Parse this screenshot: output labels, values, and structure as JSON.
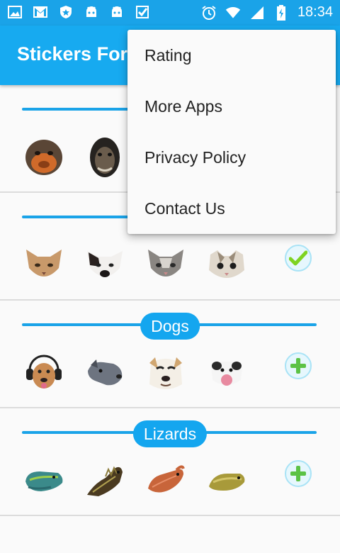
{
  "status_bar": {
    "time": "18:34",
    "left_icons": [
      "gallery-icon",
      "gmail-icon",
      "shield-icon",
      "android-icon",
      "android-icon",
      "check-app-icon"
    ],
    "right_icons": [
      "alarm-icon",
      "wifi-icon",
      "signal-icon",
      "battery-charging-icon"
    ]
  },
  "app_bar": {
    "title": "Stickers For",
    "color": "#17aaf0"
  },
  "overflow_menu": {
    "items": [
      "Rating",
      "More Apps",
      "Privacy Policy",
      "Contact Us"
    ]
  },
  "packs": [
    {
      "title": "",
      "stickers": [
        "orangutan-sticker",
        "chimpanzee-sticker"
      ],
      "action": ""
    },
    {
      "title": "",
      "stickers": [
        "cat-sticker",
        "cat-sticker",
        "cat-sticker",
        "cat-sticker"
      ],
      "action": "added-check-icon"
    },
    {
      "title": "Dogs",
      "stickers": [
        "dog-sticker",
        "dog-sticker",
        "dog-sticker",
        "dog-sticker"
      ],
      "action": "add-icon"
    },
    {
      "title": "Lizards",
      "stickers": [
        "lizard-sticker",
        "lizard-sticker",
        "lizard-sticker",
        "lizard-sticker"
      ],
      "action": "add-icon"
    }
  ],
  "colors": {
    "accent": "#14a6ef",
    "check": "#7ed321",
    "add": "#5cc245"
  }
}
